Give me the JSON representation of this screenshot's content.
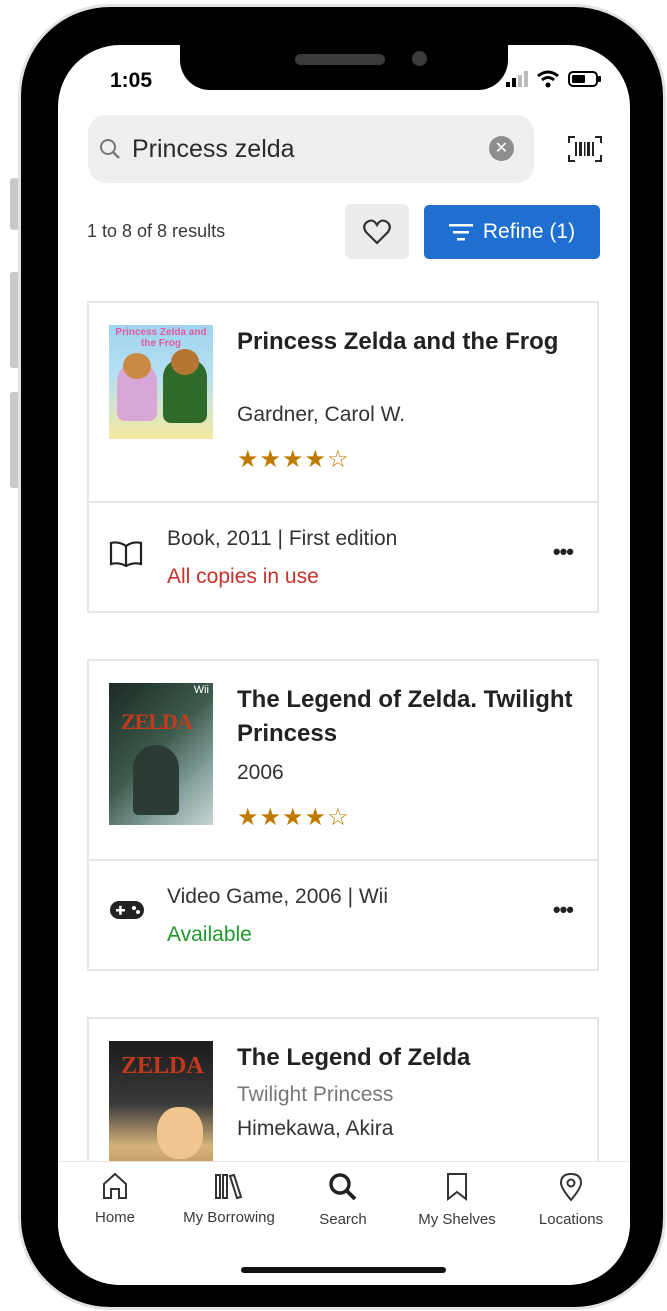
{
  "status": {
    "time": "1:05"
  },
  "search": {
    "query": "Princess zelda",
    "clear_icon": "close-circle-icon",
    "barcode_icon": "barcode-scan-icon"
  },
  "results": {
    "count_text": "1 to 8 of 8 results",
    "refine_label": "Refine (1)",
    "favorite_icon": "heart-icon"
  },
  "items": [
    {
      "title": "Princess Zelda and the Frog",
      "author": "Gardner, Carol W.",
      "rating": 4,
      "stars": "★★★★☆",
      "format_icon": "book-icon",
      "format": "Book, 2011 | First edition",
      "availability": "All copies in use",
      "availability_color": "#c8322b",
      "cover_title": "Princess Zelda and the Frog"
    },
    {
      "title": "The Legend of Zelda. Twilight Princess",
      "author": "2006",
      "rating": 4.5,
      "stars": "★★★★☆",
      "format_icon": "gamepad-icon",
      "format": "Video Game, 2006 | Wii",
      "availability": "Available",
      "availability_color": "#1e9a2c",
      "cover_title": "ZELDA",
      "cover_badge": "Wii"
    },
    {
      "title": "The Legend of Zelda",
      "subtitle": "Twilight Princess",
      "author": "Himekawa, Akira",
      "cover_title": "ZELDA"
    }
  ],
  "nav": [
    {
      "label": "Home",
      "icon": "home-icon"
    },
    {
      "label": "My Borrowing",
      "icon": "books-icon"
    },
    {
      "label": "Search",
      "icon": "search-icon"
    },
    {
      "label": "My Shelves",
      "icon": "bookmark-icon"
    },
    {
      "label": "Locations",
      "icon": "location-pin-icon"
    }
  ],
  "colors": {
    "accent": "#1f6fd1",
    "star": "#bf7a00"
  }
}
